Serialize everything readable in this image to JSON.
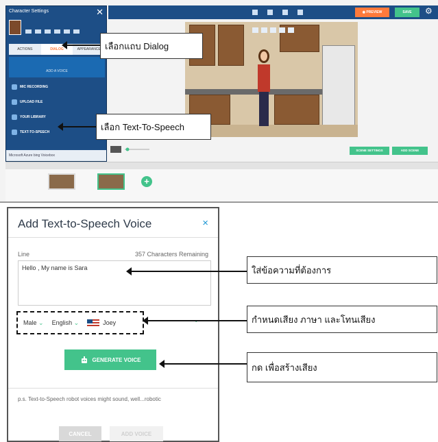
{
  "editor": {
    "panel_title": "Character Settings",
    "close_glyph": "✕",
    "tabs": [
      "ACTIONS",
      "DIALOG",
      "APPEARANCE"
    ],
    "add_voice_label": "ADD A VOICE",
    "menu": [
      "MIC RECORDING",
      "UPLOAD FILE",
      "YOUR LIBRARY",
      "TEXT-TO-SPEECH"
    ],
    "footer": "Microsoft Azure  bing  Voicebox",
    "preview_label": "◉ PREVIEW",
    "save_label": "SAVE",
    "scene_settings_label": "SCENE SETTINGS",
    "add_scene_label": "ADD SCENE"
  },
  "callouts": {
    "dialog_tab": "เลือกแถบ Dialog",
    "tts": "เลือก Text-To-Speech",
    "line": "ใส่ข้อความที่ต้องการ",
    "voice": "กำหนดเสียง ภาษา และโทนเสียง",
    "generate": "กด เพื่อสร้างเสียง"
  },
  "dialog": {
    "title": "Add Text-to-Speech Voice",
    "close_glyph": "×",
    "line_label": "Line",
    "chars_remaining": "357 Characters Remaining",
    "line_value": "Hello , My name is Sara",
    "gender": "Male",
    "language": "English",
    "voice": "Joey",
    "generate_label": "GENERATE VOICE",
    "note": "p.s. Text-to-Speech robot voices might sound, well...robotic",
    "cancel_label": "CANCEL",
    "add_voice_label": "ADD VOICE"
  },
  "colors": {
    "panel_blue": "#1d4e86",
    "accent_green": "#43c38b",
    "preview_orange": "#ff7a3b",
    "close_blue": "#1e97d4"
  }
}
